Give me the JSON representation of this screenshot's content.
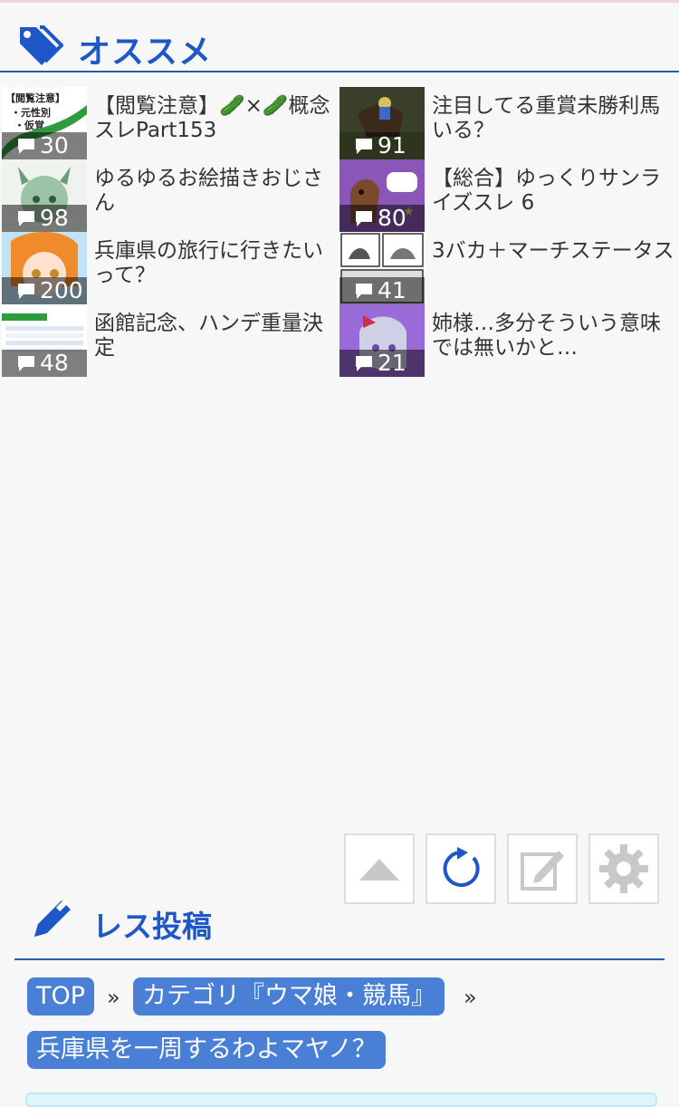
{
  "recommend": {
    "title": "オススメ",
    "items": [
      {
        "title": "【閲覧注意】🥒×🥒概念スレPart153",
        "count": "30"
      },
      {
        "title": "注目してる重賞未勝利馬いる？",
        "count": "91"
      },
      {
        "title": "ゆるゆるお絵描きおじさん",
        "count": "98"
      },
      {
        "title": "【総合】ゆっくりサンライズスレ 6",
        "count": "80"
      },
      {
        "title": "兵庫県の旅行に行きたいって？",
        "count": "200"
      },
      {
        "title": "3バカ＋マーチステータス",
        "count": "41"
      },
      {
        "title": "函館記念、ハンデ重量決定",
        "count": "48"
      },
      {
        "title": "姉様…多分そういう意味では無いかと…",
        "count": "21"
      }
    ]
  },
  "thumb_labels": {
    "t1a": "【閲覧注意】",
    "t1b": "・元性別",
    "t1c": "・仮覚"
  },
  "post": {
    "title": "レス投稿"
  },
  "breadcrumb": {
    "top": "TOP",
    "sep": "»",
    "category": "カテゴリ『ウマ娘・競馬』",
    "thread": "兵庫県を一周するわよマヤノ？"
  },
  "colors": {
    "accent": "#1e57c8",
    "crumb_bg": "#4a7fd6",
    "divider": "#2a5ab5"
  }
}
